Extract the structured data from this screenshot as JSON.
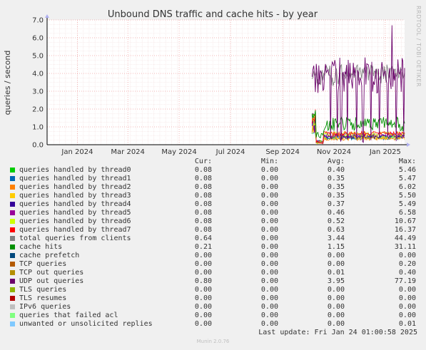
{
  "chart_data": {
    "type": "line",
    "title": "Unbound DNS traffic and cache hits - by year",
    "ylabel": "queries / second",
    "side_label": "RRDTOOL / TOBI OETIKER",
    "ylim": [
      0,
      7
    ],
    "y_ticks": [
      "0.0",
      "1.0",
      "2.0",
      "3.0",
      "4.0",
      "5.0",
      "6.0",
      "7.0"
    ],
    "x_range": [
      "2023-11-26",
      "2025-01-24"
    ],
    "x_ticks": [
      {
        "label": "Jan 2024",
        "date": "2024-01-01"
      },
      {
        "label": "Mar 2024",
        "date": "2024-03-01"
      },
      {
        "label": "May 2024",
        "date": "2024-05-01"
      },
      {
        "label": "Jul 2024",
        "date": "2024-07-01"
      },
      {
        "label": "Sep 2024",
        "date": "2024-09-01"
      },
      {
        "label": "Nov 2024",
        "date": "2024-11-01"
      },
      {
        "label": "Jan 2025",
        "date": "2025-01-01"
      }
    ],
    "grid": true,
    "legend_columns": [
      "Cur:",
      "Min:",
      "Avg:",
      "Max:"
    ],
    "series": [
      {
        "name": "queries handled by thread0",
        "color": "#00cc00",
        "cur": "0.08",
        "min": "0.00",
        "avg": "0.40",
        "max": "5.46"
      },
      {
        "name": "queries handled by thread1",
        "color": "#0066b3",
        "cur": "0.08",
        "min": "0.00",
        "avg": "0.35",
        "max": "5.47"
      },
      {
        "name": "queries handled by thread2",
        "color": "#ff8000",
        "cur": "0.08",
        "min": "0.00",
        "avg": "0.35",
        "max": "6.02"
      },
      {
        "name": "queries handled by thread3",
        "color": "#ffcc00",
        "cur": "0.08",
        "min": "0.00",
        "avg": "0.35",
        "max": "5.50"
      },
      {
        "name": "queries handled by thread4",
        "color": "#330099",
        "cur": "0.08",
        "min": "0.00",
        "avg": "0.37",
        "max": "5.49"
      },
      {
        "name": "queries handled by thread5",
        "color": "#990099",
        "cur": "0.08",
        "min": "0.00",
        "avg": "0.46",
        "max": "6.58"
      },
      {
        "name": "queries handled by thread6",
        "color": "#ccff00",
        "cur": "0.08",
        "min": "0.00",
        "avg": "0.52",
        "max": "10.67"
      },
      {
        "name": "queries handled by thread7",
        "color": "#ff0000",
        "cur": "0.08",
        "min": "0.00",
        "avg": "0.63",
        "max": "16.37"
      },
      {
        "name": "total queries from clients",
        "color": "#808080",
        "cur": "0.64",
        "min": "0.00",
        "avg": "3.44",
        "max": "44.49"
      },
      {
        "name": "cache hits",
        "color": "#008f00",
        "cur": "0.21",
        "min": "0.00",
        "avg": "1.15",
        "max": "31.11"
      },
      {
        "name": "cache prefetch",
        "color": "#00487d",
        "cur": "0.00",
        "min": "0.00",
        "avg": "0.00",
        "max": "0.00"
      },
      {
        "name": "TCP queries",
        "color": "#b35a00",
        "cur": "0.00",
        "min": "0.00",
        "avg": "0.00",
        "max": "0.20"
      },
      {
        "name": "TCP out queries",
        "color": "#b38f00",
        "cur": "0.00",
        "min": "0.00",
        "avg": "0.01",
        "max": "0.40"
      },
      {
        "name": "UDP out queries",
        "color": "#6b006b",
        "cur": "0.80",
        "min": "0.00",
        "avg": "3.95",
        "max": "77.19"
      },
      {
        "name": "TLS queries",
        "color": "#8fb300",
        "cur": "0.00",
        "min": "0.00",
        "avg": "0.00",
        "max": "0.00"
      },
      {
        "name": "TLS resumes",
        "color": "#b30000",
        "cur": "0.00",
        "min": "0.00",
        "avg": "0.00",
        "max": "0.00"
      },
      {
        "name": "IPv6 queries",
        "color": "#bebebe",
        "cur": "0.00",
        "min": "0.00",
        "avg": "0.00",
        "max": "0.00"
      },
      {
        "name": "queries that failed acl",
        "color": "#80ff80",
        "cur": "0.00",
        "min": "0.00",
        "avg": "0.00",
        "max": "0.00"
      },
      {
        "name": "unwanted or unsolicited replies",
        "color": "#80c9ff",
        "cur": "0.00",
        "min": "0.00",
        "avg": "0.00",
        "max": "0.01"
      }
    ]
  },
  "footer": {
    "last_update": "Last update:  Fri Jan 24 01:00:58 2025",
    "generator": "Munin 2.0.76"
  }
}
